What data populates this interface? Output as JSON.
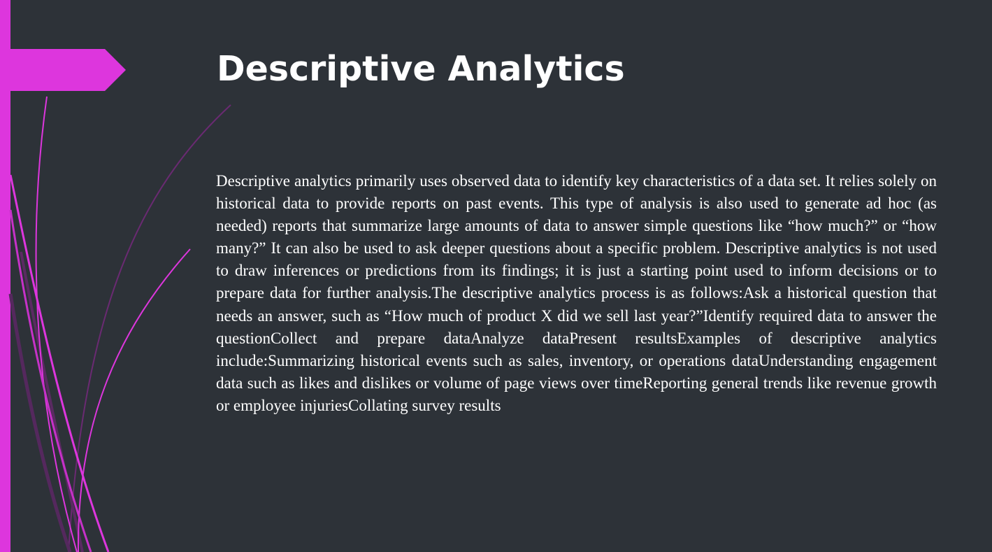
{
  "slide": {
    "title": "Descriptive Analytics",
    "body": "Descriptive analytics primarily uses observed data to identify key characteristics of a data set. It relies solely on historical data to provide reports on past events. This type of analysis is also used to generate ad hoc (as needed) reports that summarize large amounts of data to answer simple questions like “how much?” or “how many?” It can also be used to ask deeper questions about a specific problem. Descriptive analytics is not used to draw inferences or predictions from its findings; it is just a starting point used to inform decisions or to prepare data for further analysis.The descriptive analytics process is as follows:Ask a historical question that needs an answer, such as “How much of product X did we sell last year?”Identify required data to answer the questionCollect and prepare dataAnalyze dataPresent resultsExamples of descriptive analytics include:Summarizing historical events such as sales, inventory, or operations dataUnderstanding engagement data such as likes and dislikes or volume of page views over timeReporting general trends like revenue growth or employee injuriesCollating survey results"
  },
  "colors": {
    "background": "#2d3238",
    "accent": "#dd36dd",
    "text": "#ffffff"
  }
}
